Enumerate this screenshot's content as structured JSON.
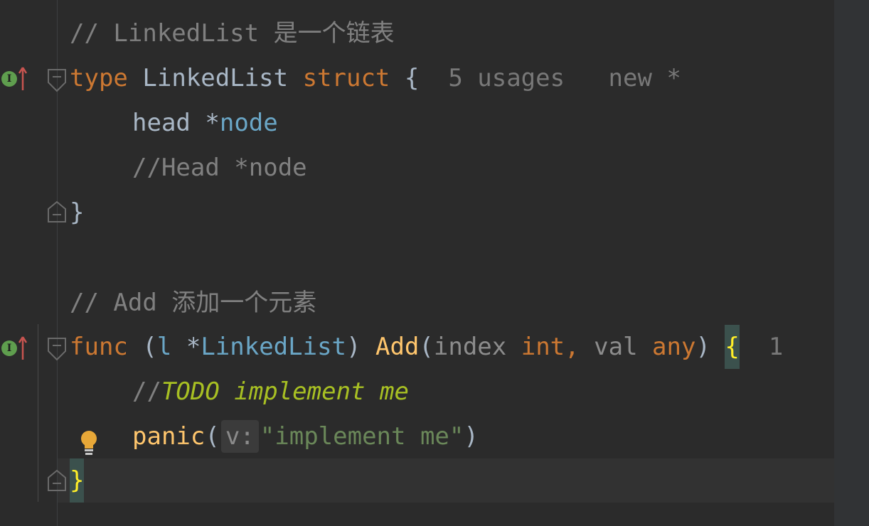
{
  "editor": {
    "lines": {
      "c1": "// LinkedList 是一个链表",
      "l2": {
        "kw_type": "type",
        "name": "LinkedList",
        "kw_struct": "struct",
        "brace": "{",
        "usages": "5 usages",
        "author": "new *"
      },
      "l3": {
        "field": "head",
        "star": "*",
        "type": "node"
      },
      "l4": "//Head *node",
      "l5": "}",
      "c7": "// Add 添加一个元素",
      "l8": {
        "kw_func": "func",
        "open": "(",
        "recv": "l",
        "star": "*",
        "recv_type": "LinkedList",
        "close": ")",
        "method": "Add",
        "popen": "(",
        "p1": "index",
        "p1_type": "int",
        "comma": ",",
        "p2": "val",
        "p2_type": "any",
        "pclose": ")",
        "brace": "{",
        "usages": "1"
      },
      "l9": {
        "prefix": "//",
        "todo": "TODO implement me"
      },
      "l10": {
        "fn": "panic",
        "open": "(",
        "hint": "v:",
        "arg": "\"implement me\"",
        "close": ")"
      },
      "l11": "}"
    },
    "gutter": {
      "impl_icon_label": "I"
    }
  },
  "colors": {
    "background": "#2b2b2b",
    "keyword": "#cc7832",
    "function": "#ffc66d",
    "string": "#6a8759",
    "comment": "#808080",
    "todo": "#a8c023",
    "type_ref": "#6aa6c6"
  }
}
